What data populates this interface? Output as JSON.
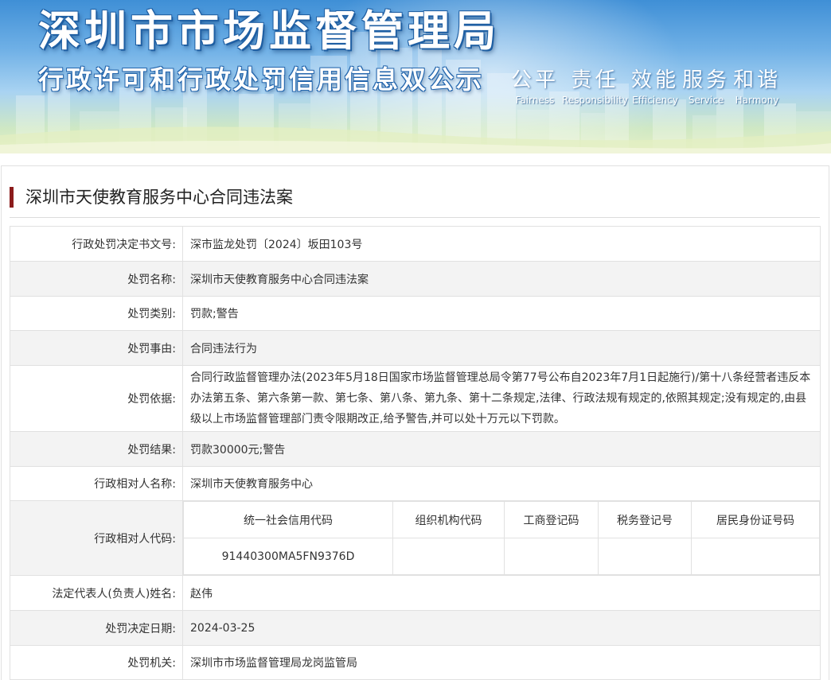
{
  "banner": {
    "title": "深圳市市场监督管理局",
    "subtitle": "行政许可和行政处罚信用信息双公示",
    "slogans": [
      {
        "zh": "公平",
        "en": "Fairness"
      },
      {
        "zh": "责任",
        "en": "Responsibility"
      },
      {
        "zh": "效能",
        "en": "Efficiency"
      },
      {
        "zh": "服务",
        "en": "Service"
      },
      {
        "zh": "和谐",
        "en": "Harmony"
      }
    ]
  },
  "case": {
    "heading": "深圳市天使教育服务中心合同违法案",
    "rows": {
      "decision_no": {
        "label": "行政处罚决定书文号:",
        "value": "深市监龙处罚〔2024〕坂田103号"
      },
      "name": {
        "label": "处罚名称:",
        "value": "深圳市天使教育服务中心合同违法案"
      },
      "category": {
        "label": "处罚类别:",
        "value": "罚款;警告"
      },
      "reason": {
        "label": "处罚事由:",
        "value": "合同违法行为"
      },
      "basis": {
        "label": "处罚依据:",
        "value": "合同行政监督管理办法(2023年5月18日国家市场监督管理总局令第77号公布自2023年7月1日起施行)/第十八条经营者违反本办法第五条、第六条第一款、第七条、第八条、第九条、第十二条规定,法律、行政法规有规定的,依照其规定;没有规定的,由县级以上市场监督管理部门责令限期改正,给予警告,并可以处十万元以下罚款。"
      },
      "result": {
        "label": "处罚结果:",
        "value": "罚款30000元;警告"
      },
      "party_name": {
        "label": "行政相对人名称:",
        "value": "深圳市天使教育服务中心"
      },
      "party_code": {
        "label": "行政相对人代码:",
        "headers": [
          "统一社会信用代码",
          "组织机构代码",
          "工商登记码",
          "税务登记号",
          "居民身份证号码"
        ],
        "values": [
          "91440300MA5FN9376D",
          "",
          "",
          "",
          ""
        ]
      },
      "legal_rep": {
        "label": "法定代表人(负责人)姓名:",
        "value": "赵伟"
      },
      "date": {
        "label": "处罚决定日期:",
        "value": "2024-03-25"
      },
      "authority": {
        "label": "处罚机关:",
        "value": "深圳市市场监督管理局龙岗监管局"
      }
    }
  }
}
